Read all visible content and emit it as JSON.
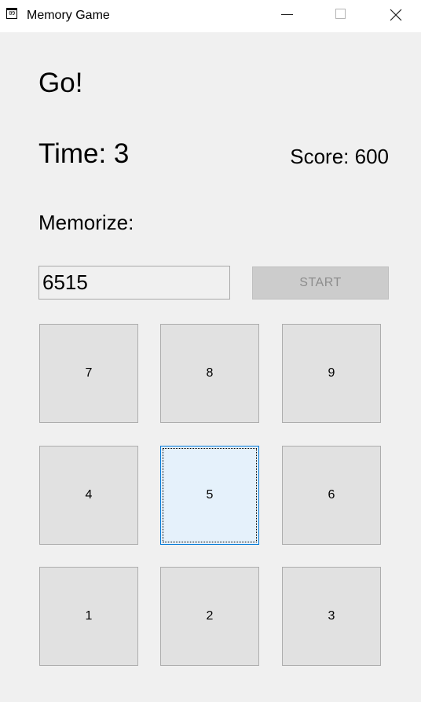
{
  "window": {
    "title": "Memory Game",
    "icon_text": "09"
  },
  "status": {
    "message": "Go!",
    "time": "Time: 3",
    "score": "Score: 600",
    "memorize_label": "Memorize:"
  },
  "input": {
    "value": "6515"
  },
  "start_button": {
    "label": "START",
    "enabled": false
  },
  "keypad": {
    "keys": [
      "7",
      "8",
      "9",
      "4",
      "5",
      "6",
      "1",
      "2",
      "3"
    ],
    "focused_key": "5"
  },
  "colors": {
    "window_bg": "#f0f0f0",
    "key_bg": "#e1e1e1",
    "focus_border": "#0078d7",
    "disabled_button_bg": "#cccccc"
  }
}
